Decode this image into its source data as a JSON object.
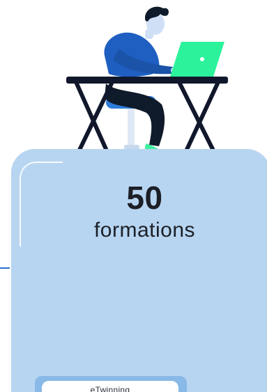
{
  "stat": {
    "number": "50",
    "label": "formations"
  },
  "tag": {
    "label": "eTwinning"
  },
  "illustration": {
    "subject": "person-working-on-laptop",
    "colors": {
      "card": "#b7d5f1",
      "laptop": "#2cf39b",
      "shirt": "#1f5fc2",
      "hair": "#0f1a2b",
      "desk": "#11182c"
    }
  }
}
